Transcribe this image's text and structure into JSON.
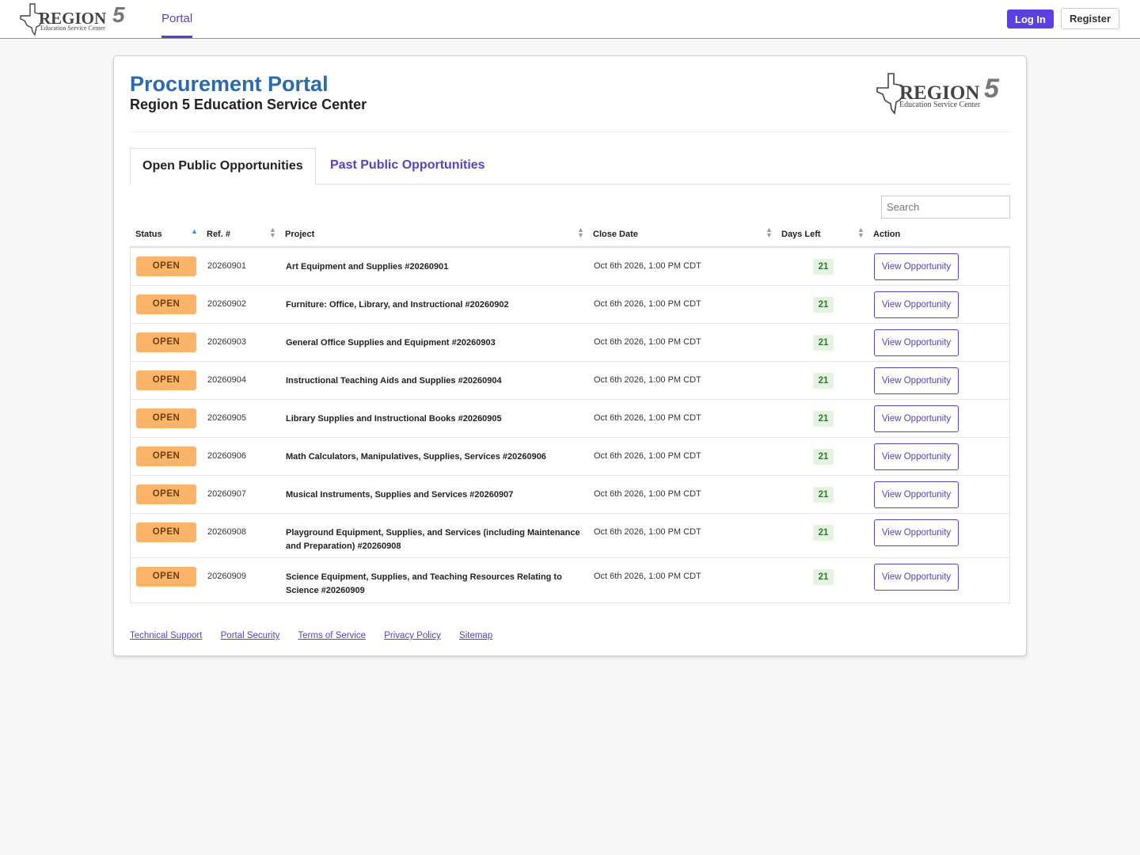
{
  "nav": {
    "portal_tab": "Portal",
    "login": "Log In",
    "register": "Register"
  },
  "header": {
    "title": "Procurement Portal",
    "subtitle": "Region 5 Education Service Center"
  },
  "logo": {
    "text": "REGION",
    "number": "5",
    "tagline": "Education Service Center"
  },
  "tabs": {
    "open": "Open Public Opportunities",
    "past": "Past Public Opportunities"
  },
  "search": {
    "placeholder": "Search"
  },
  "table": {
    "columns": [
      "Status",
      "Ref. #",
      "Project",
      "Close Date",
      "Days Left",
      "Action"
    ],
    "rows": [
      {
        "status": "OPEN",
        "ref": "20260901",
        "project": "Art Equipment and Supplies #20260901",
        "close_date": "Oct 6th 2026, 1:00 PM CDT",
        "days_left": "21",
        "action": "View Opportunity"
      },
      {
        "status": "OPEN",
        "ref": "20260902",
        "project": "Furniture: Office, Library, and Instructional #20260902",
        "close_date": "Oct 6th 2026, 1:00 PM CDT",
        "days_left": "21",
        "action": "View Opportunity"
      },
      {
        "status": "OPEN",
        "ref": "20260903",
        "project": "General Office Supplies and Equipment #20260903",
        "close_date": "Oct 6th 2026, 1:00 PM CDT",
        "days_left": "21",
        "action": "View Opportunity"
      },
      {
        "status": "OPEN",
        "ref": "20260904",
        "project": "Instructional Teaching Aids and Supplies #20260904",
        "close_date": "Oct 6th 2026, 1:00 PM CDT",
        "days_left": "21",
        "action": "View Opportunity"
      },
      {
        "status": "OPEN",
        "ref": "20260905",
        "project": "Library Supplies and Instructional Books #20260905",
        "close_date": "Oct 6th 2026, 1:00 PM CDT",
        "days_left": "21",
        "action": "View Opportunity"
      },
      {
        "status": "OPEN",
        "ref": "20260906",
        "project": "Math Calculators, Manipulatives, Supplies, Services #20260906",
        "close_date": "Oct 6th 2026, 1:00 PM CDT",
        "days_left": "21",
        "action": "View Opportunity"
      },
      {
        "status": "OPEN",
        "ref": "20260907",
        "project": "Musical Instruments, Supplies and Services #20260907",
        "close_date": "Oct 6th 2026, 1:00 PM CDT",
        "days_left": "21",
        "action": "View Opportunity"
      },
      {
        "status": "OPEN",
        "ref": "20260908",
        "project": "Playground Equipment, Supplies, and Services (including Maintenance and Preparation) #20260908",
        "close_date": "Oct 6th 2026, 1:00 PM CDT",
        "days_left": "21",
        "action": "View Opportunity"
      },
      {
        "status": "OPEN",
        "ref": "20260909",
        "project": "Science Equipment, Supplies, and Teaching Resources Relating to Science #20260909",
        "close_date": "Oct 6th 2026, 1:00 PM CDT",
        "days_left": "21",
        "action": "View Opportunity"
      }
    ]
  },
  "footer": {
    "links": [
      "Technical Support",
      "Portal Security",
      "Terms of Service",
      "Privacy Policy",
      "Sitemap"
    ]
  },
  "colors": {
    "accent": "#5a3fc7",
    "title_blue": "#2a6bb0",
    "open_badge": "#fbb46a",
    "days_badge": "#e3f3e0"
  }
}
